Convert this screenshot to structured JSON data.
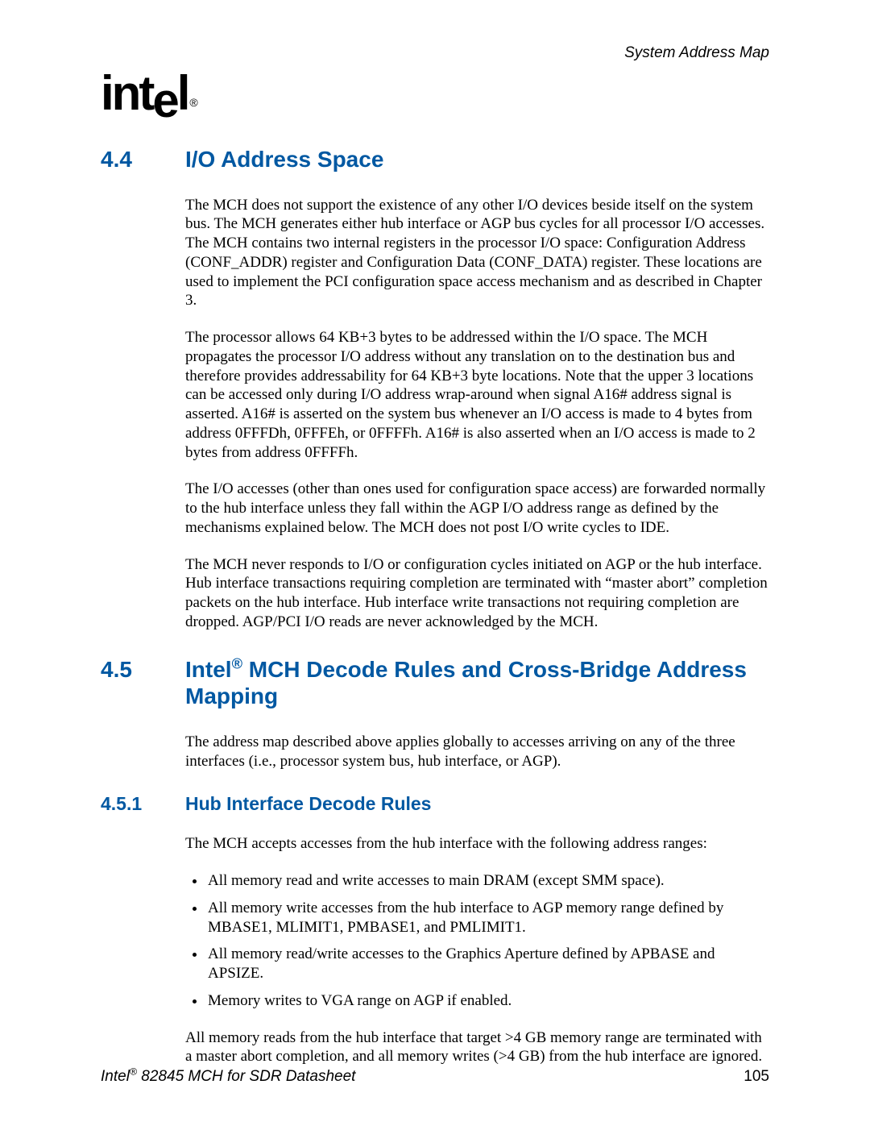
{
  "header": {
    "chapter_title": "System Address Map"
  },
  "logo": {
    "text": "intel",
    "mark": "®"
  },
  "sections": {
    "s44": {
      "num": "4.4",
      "title": "I/O Address Space",
      "p1": "The MCH does not support the existence of any other I/O devices beside itself on the system bus. The MCH generates either hub interface or AGP bus cycles for all processor I/O accesses. The MCH contains two internal registers in the processor I/O space: Configuration Address (CONF_ADDR) register and Configuration Data (CONF_DATA) register. These locations are used to implement the PCI configuration space access mechanism and as described in Chapter 3.",
      "p2": "The processor allows 64 KB+3 bytes to be addressed within the I/O space. The MCH propagates the processor I/O address without any translation on to the destination bus and therefore provides addressability for 64 KB+3 byte locations. Note that the upper 3 locations can be accessed only during I/O address wrap-around when signal A16# address signal is asserted. A16# is asserted on the system bus whenever an I/O access is made to 4 bytes from address 0FFFDh, 0FFFEh, or 0FFFFh. A16# is also asserted when an I/O access is made to 2 bytes from address 0FFFFh.",
      "p3": "The I/O accesses (other than ones used for configuration space access) are forwarded normally to the hub interface unless they fall within the AGP I/O address range as defined by the mechanisms explained below. The MCH does not post I/O write cycles to IDE.",
      "p4": "The MCH never responds to I/O or configuration cycles initiated on AGP or the hub interface. Hub interface transactions requiring completion are terminated with “master abort” completion packets on the hub interface. Hub interface write transactions not requiring completion are dropped. AGP/PCI I/O reads are never acknowledged by the MCH."
    },
    "s45": {
      "num": "4.5",
      "title_pre": "Intel",
      "title_reg": "®",
      "title_post": " MCH Decode Rules and Cross-Bridge Address Mapping",
      "p1": "The address map described above applies globally to accesses arriving on any of the three interfaces (i.e., processor system bus, hub interface, or AGP)."
    },
    "s451": {
      "num": "4.5.1",
      "title": "Hub Interface Decode Rules",
      "p1": "The MCH accepts accesses from the hub interface with the following address ranges:",
      "bullets": {
        "b0": "All memory read and write accesses to main DRAM (except SMM space).",
        "b1": "All memory write accesses from the hub interface to AGP memory range defined by MBASE1, MLIMIT1, PMBASE1, and PMLIMIT1.",
        "b2": "All memory read/write accesses to the Graphics Aperture defined by APBASE and APSIZE.",
        "b3": "Memory writes to VGA range on AGP if enabled."
      },
      "p2": "All memory reads from the hub interface that target >4 GB memory range are terminated with a master abort completion, and all memory writes (>4 GB) from the hub interface are ignored."
    }
  },
  "footer": {
    "left_pre": "Intel",
    "left_reg": "®",
    "left_post": " 82845 MCH for SDR Datasheet",
    "page_number": "105"
  }
}
